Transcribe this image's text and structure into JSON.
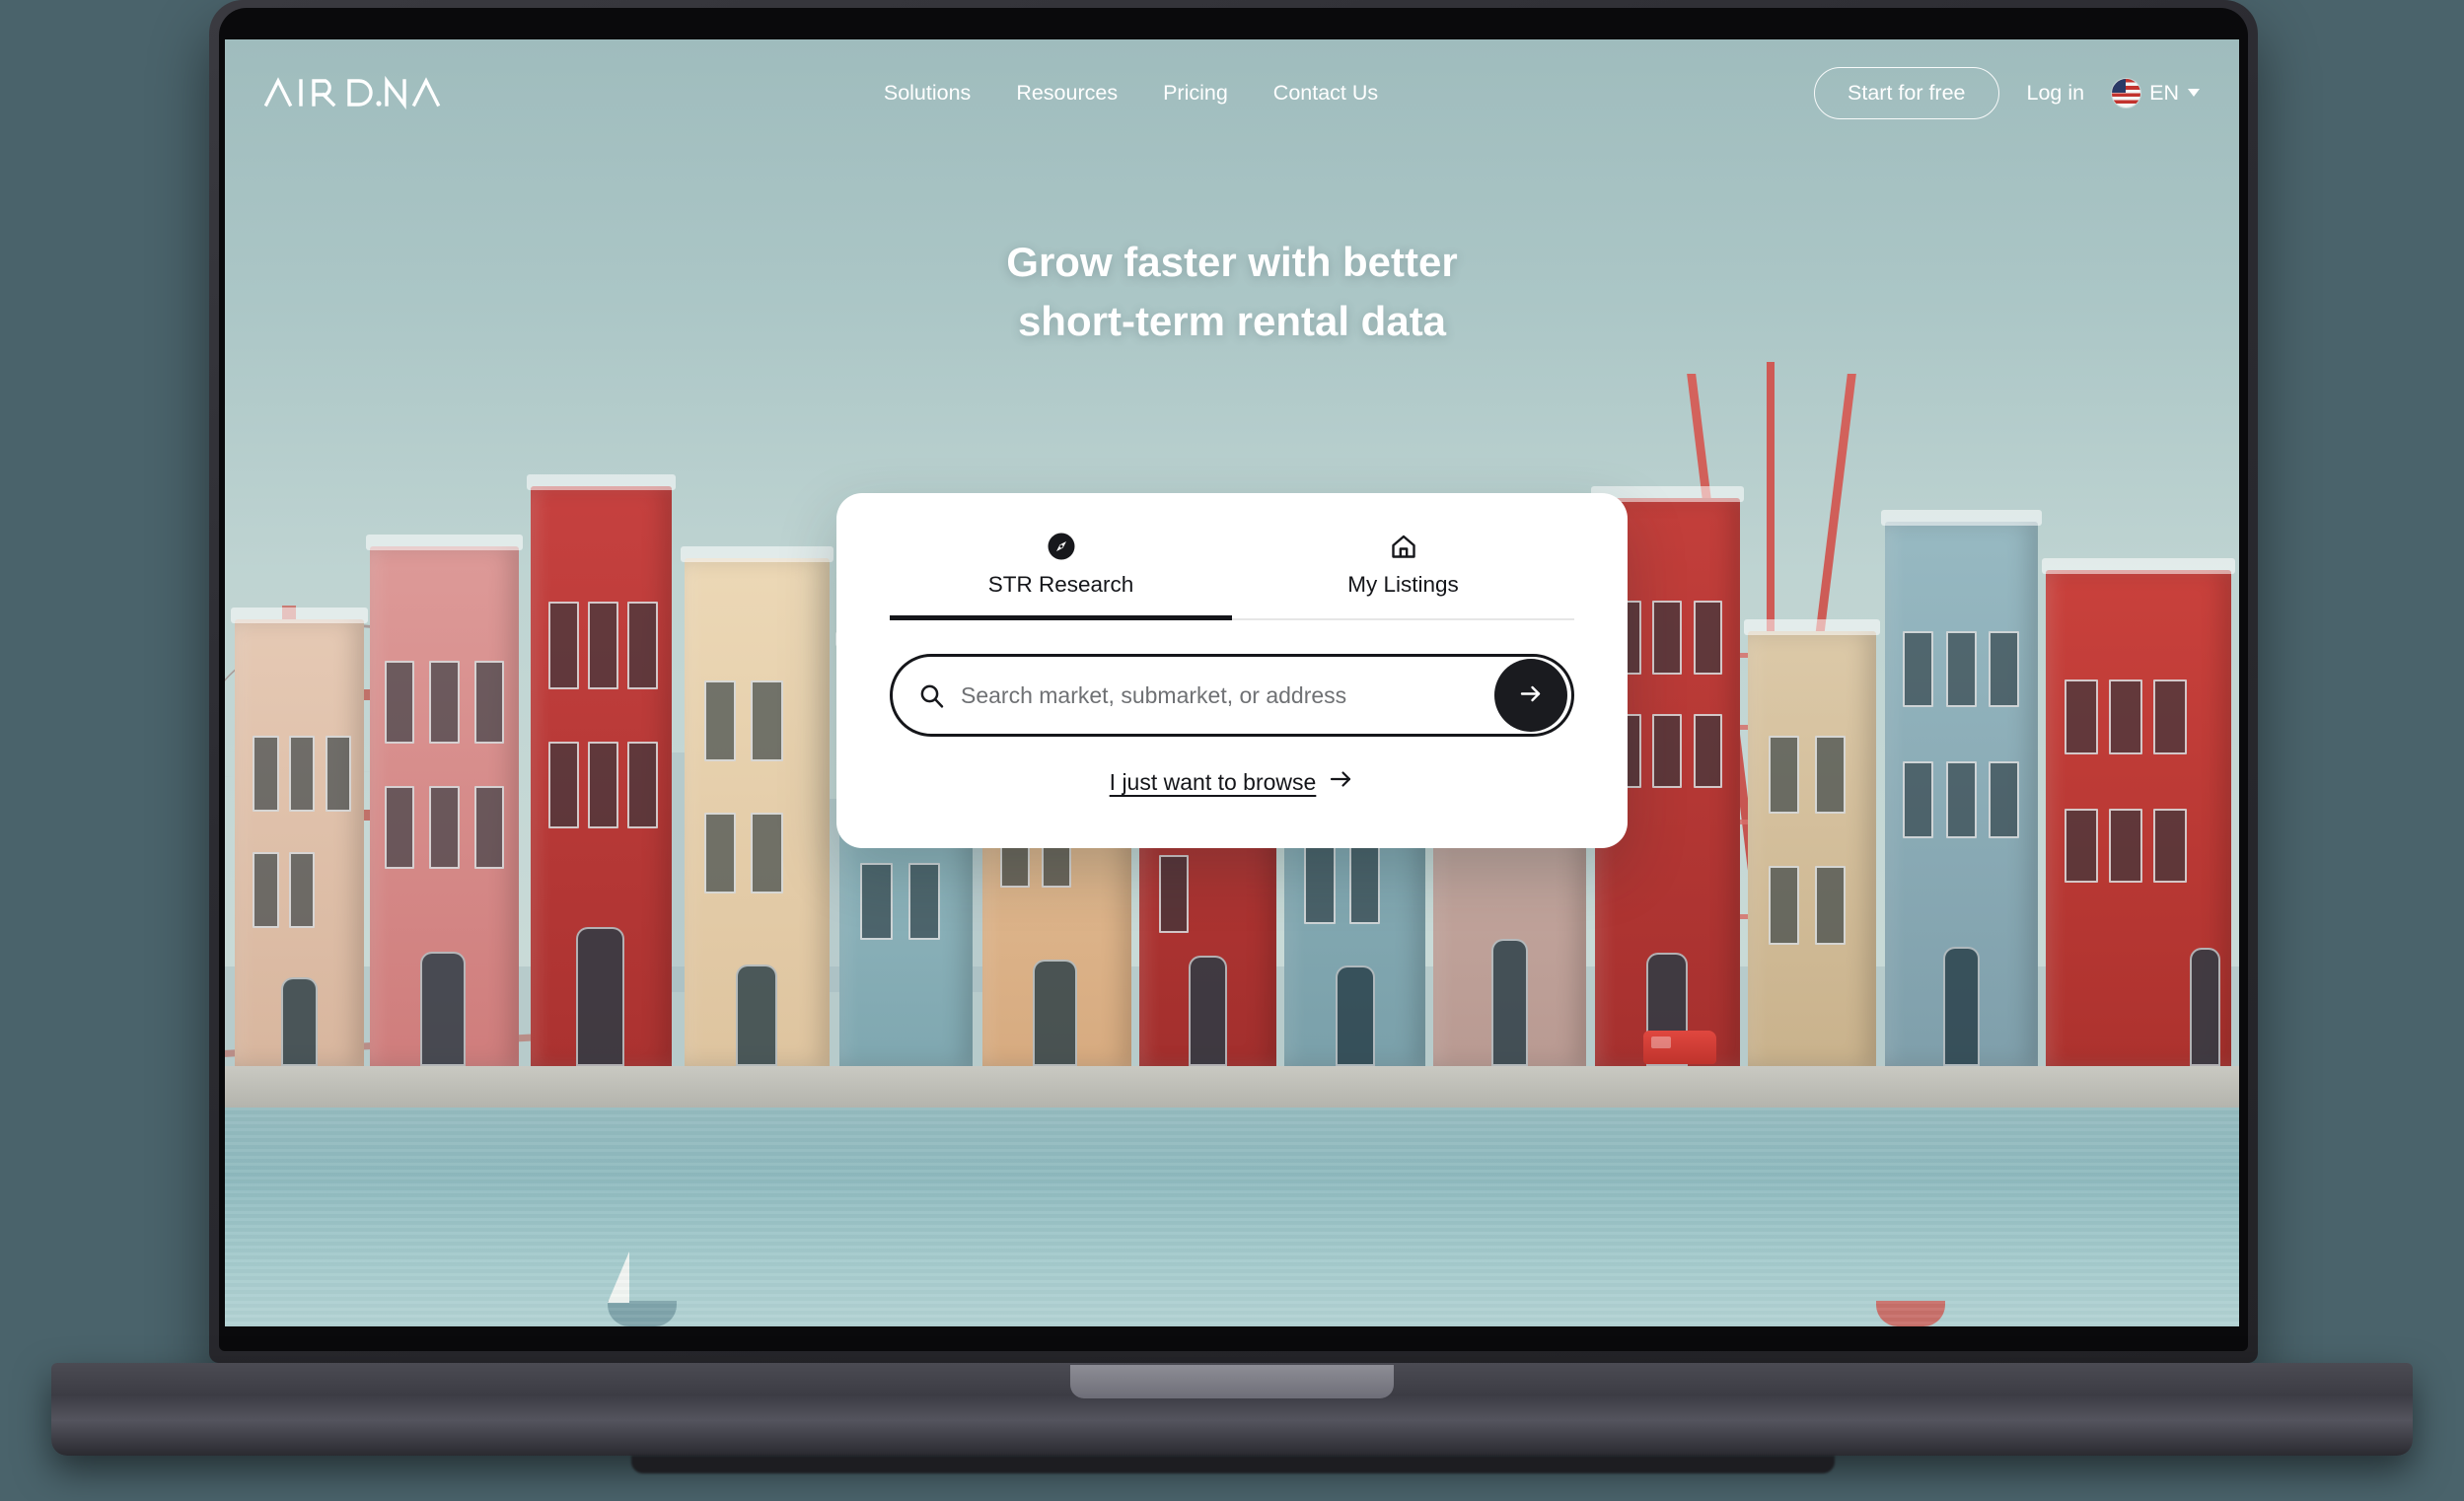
{
  "brand": {
    "logo_text": "AIRDNA"
  },
  "nav": {
    "items": [
      {
        "label": "Solutions",
        "name": "nav-solutions"
      },
      {
        "label": "Resources",
        "name": "nav-resources"
      },
      {
        "label": "Pricing",
        "name": "nav-pricing"
      },
      {
        "label": "Contact Us",
        "name": "nav-contact-us"
      }
    ]
  },
  "header_actions": {
    "start_free_label": "Start for free",
    "login_label": "Log in",
    "language_label": "EN",
    "flag_icon": "us-flag-icon",
    "caret_icon": "chevron-down-icon"
  },
  "hero": {
    "line1": "Grow faster with better",
    "line2": "short-term rental data"
  },
  "search_card": {
    "tabs": [
      {
        "label": "STR Research",
        "icon": "compass-icon",
        "active": true
      },
      {
        "label": "My Listings",
        "icon": "home-icon",
        "active": false
      }
    ],
    "search": {
      "placeholder": "Search market, submarket, or address",
      "value": "",
      "icon": "search-icon",
      "submit_icon": "arrow-right-icon"
    },
    "browse": {
      "label": "I just want to browse",
      "icon": "arrow-right-icon"
    }
  },
  "artwork": {
    "description": "miniature diorama San Francisco waterfront cityscape",
    "sky_color": "#abc6c6",
    "water_color": "#96bcc0",
    "accent_red": "#c9403c",
    "accent_blue": "#7fa4ae"
  },
  "device": {
    "type": "laptop-mockup",
    "background_color": "#4a636b"
  }
}
